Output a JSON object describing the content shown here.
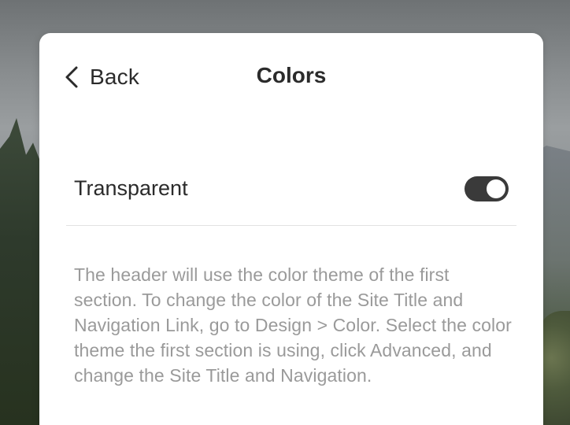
{
  "header": {
    "back_label": "Back",
    "title": "Colors"
  },
  "setting": {
    "label": "Transparent",
    "toggle_on": true
  },
  "description": "The header will use the color theme of the first section. To change the color of the Site Title and Navigation Link, go to Design > Color. Select the color theme the first section is using, click Advanced, and change the Site Title and Navigation.",
  "colors": {
    "panel_background": "#ffffff",
    "text_primary": "#2b2b2b",
    "text_secondary": "#9a9a9a",
    "toggle_on": "#3a3a3a",
    "divider": "#e2e2e2"
  },
  "icons": {
    "back": "chevron-left-icon"
  }
}
